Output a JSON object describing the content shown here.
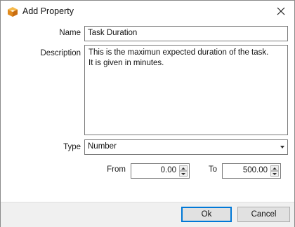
{
  "window": {
    "title": "Add Property",
    "icon": "cube-icon",
    "close_icon": "close-icon"
  },
  "form": {
    "name_label": "Name",
    "name_value": "Task Duration",
    "description_label": "Description",
    "description_value": "This is the maximun expected duration of the task.\nIt is given in minutes.",
    "type_label": "Type",
    "type_value": "Number",
    "from_label": "From",
    "from_value": "0.00",
    "to_label": "To",
    "to_value": "500.00"
  },
  "buttons": {
    "ok_label": "Ok",
    "cancel_label": "Cancel"
  },
  "colors": {
    "icon_orange": "#f0a030",
    "focus_blue": "#0078d7"
  }
}
